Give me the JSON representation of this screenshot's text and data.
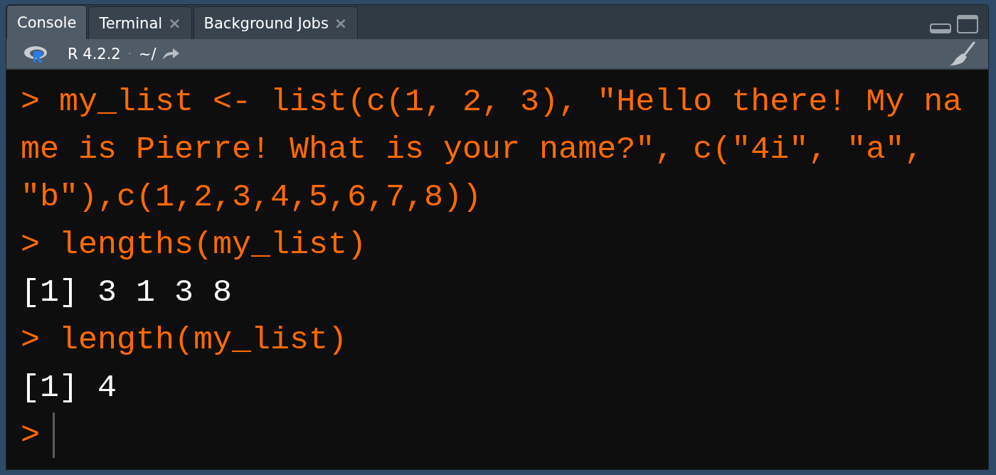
{
  "tabs": [
    {
      "label": "Console",
      "selected": true,
      "closable": false
    },
    {
      "label": "Terminal",
      "selected": false,
      "closable": true
    },
    {
      "label": "Background Jobs",
      "selected": false,
      "closable": true
    }
  ],
  "close_glyph": "×",
  "toolbar": {
    "version": "R 4.2.2",
    "separator": "·",
    "directory": "~/"
  },
  "console": {
    "lines": [
      {
        "kind": "command",
        "prompt": ">",
        "text": "my_list <- list(c(1, 2, 3), \"Hello there! My name is Pierre! What is your name?\", c(\"4i\", \"a\", \"b\"),c(1,2,3,4,5,6,7,8))"
      },
      {
        "kind": "command",
        "prompt": ">",
        "text": "lengths(my_list)"
      },
      {
        "kind": "output",
        "text": "[1] 3 1 3 8"
      },
      {
        "kind": "command",
        "prompt": ">",
        "text": "length(my_list)"
      },
      {
        "kind": "output",
        "text": "[1] 4"
      },
      {
        "kind": "input",
        "prompt": ">"
      }
    ]
  }
}
